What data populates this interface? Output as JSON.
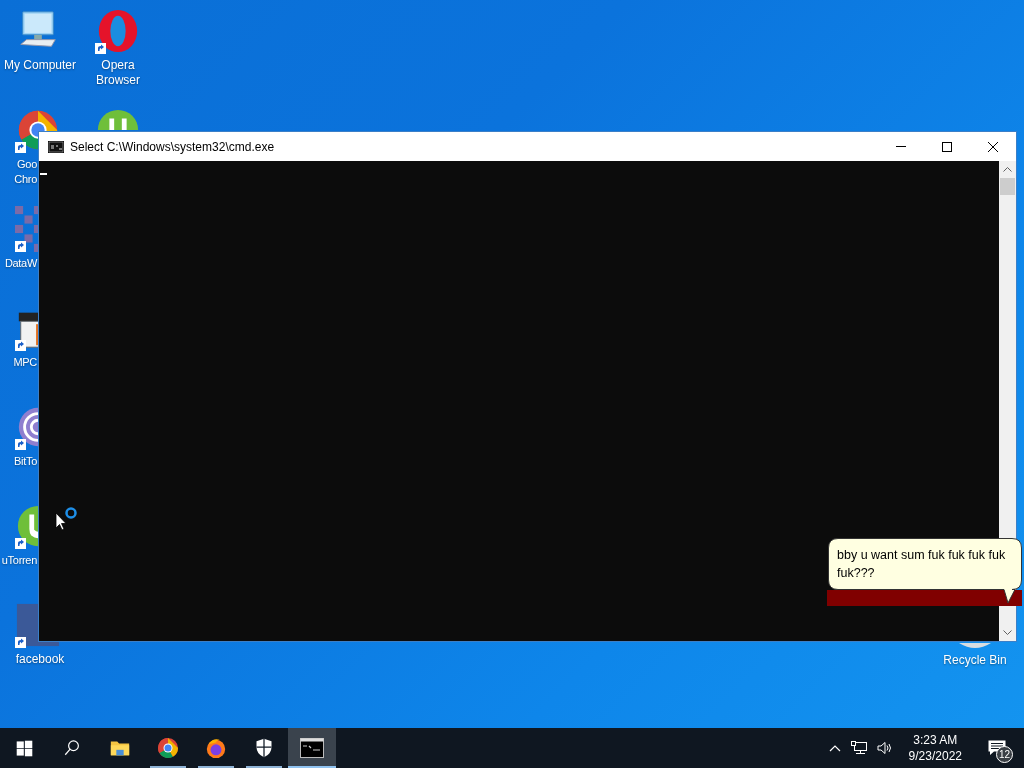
{
  "desktop_icons": [
    {
      "kind": "computer",
      "lines": [
        "My Computer"
      ],
      "shortcut": false
    },
    {
      "kind": "opera",
      "lines": [
        "Opera",
        "Browser"
      ],
      "shortcut": true
    },
    {
      "kind": "chrome",
      "lines": [
        "Goo",
        "Chro"
      ],
      "shortcut": true
    },
    {
      "kind": "utorrent",
      "shortcut": false
    },
    {
      "kind": "datawrapper",
      "lines": [
        "DataW"
      ],
      "shortcut": true
    },
    {
      "kind": "mpc",
      "lines": [
        "MPC"
      ],
      "shortcut": true
    },
    {
      "kind": "bittorrent",
      "lines": [
        "BitTo"
      ],
      "shortcut": true
    },
    {
      "kind": "utorrent",
      "lines": [
        "uTorren"
      ],
      "shortcut": true
    },
    {
      "kind": "facebook",
      "lines": [
        "facebook"
      ],
      "shortcut": true
    }
  ],
  "recycle_bin": {
    "label": "Recycle Bin"
  },
  "window": {
    "title": "Select C:\\Windows\\system32\\cmd.exe"
  },
  "balloon": {
    "text": "bby u want sum fuk fuk fuk fuk fuk???"
  },
  "taskbar": {
    "items": [
      {
        "kind": "start",
        "selected": false,
        "running": false
      },
      {
        "kind": "search",
        "selected": false,
        "running": false
      },
      {
        "kind": "explorer",
        "selected": false,
        "running": false
      },
      {
        "kind": "chrome",
        "selected": false,
        "running": true
      },
      {
        "kind": "firefox",
        "selected": false,
        "running": true
      },
      {
        "kind": "shield",
        "selected": false,
        "running": true
      },
      {
        "kind": "terminal",
        "selected": true,
        "running": true
      }
    ],
    "time": "3:23 AM",
    "date": "9/23/2022",
    "notifications": "12"
  }
}
